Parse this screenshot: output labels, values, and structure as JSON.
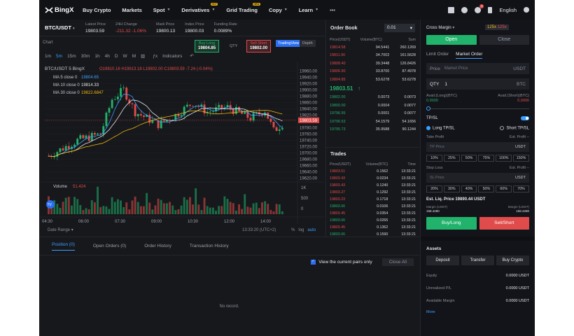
{
  "nav": {
    "logo": "BingX",
    "items": [
      {
        "label": "Buy Crypto",
        "chev": false,
        "badge": ""
      },
      {
        "label": "Markets",
        "chev": false,
        "badge": ""
      },
      {
        "label": "Spot",
        "chev": true,
        "badge": ""
      },
      {
        "label": "Derivatives",
        "chev": true,
        "badge": "HOT"
      },
      {
        "label": "Grid Trading",
        "chev": false,
        "badge": "NEW"
      },
      {
        "label": "Copy",
        "chev": true,
        "badge": ""
      },
      {
        "label": "Learn",
        "chev": true,
        "badge": ""
      }
    ],
    "more": "•••",
    "notif_count": "9",
    "language": "English"
  },
  "ticker": {
    "pair": "BTC/USDT",
    "stats": [
      {
        "label": "Latest Price",
        "value": "19803.59",
        "tone": "normal"
      },
      {
        "label": "24H Change",
        "value": "-211.32 -1.06%",
        "tone": "red"
      },
      {
        "label": "Mark Price",
        "value": "19800.13",
        "tone": "normal"
      },
      {
        "label": "Index Price",
        "value": "19800.03",
        "tone": "normal"
      },
      {
        "label": "Funding Rate",
        "value": "0.0089%",
        "tone": "normal"
      }
    ]
  },
  "chart": {
    "panel_title": "Chart",
    "timeframes": [
      "1m",
      "5m",
      "15m",
      "30m",
      "1h",
      "4h",
      "D",
      "W",
      "M"
    ],
    "active_tf": "5m",
    "indicators_label": "Indicators",
    "buy_long": {
      "label": "Buy Long",
      "price": "19804.85"
    },
    "qty_label": "QTY",
    "sell_short": {
      "label": "Sell Short",
      "price": "19802.00"
    },
    "tradingview_tab": "TradingView",
    "depth_tab": "Depth",
    "legend_pair": "BTC/USDT  5  BingX",
    "ohlc": "O19810.16  H19813.18  L19802.00  C19803.59  -7.24 (-0.04%)",
    "ma5": "MA 5 close 0",
    "ma5_val": "19804.65",
    "ma10": "MA 10 close 0",
    "ma10_val": "19814.33",
    "ma30": "MA 30 close 0",
    "ma30_val": "19822.6847",
    "volume_label": "Volume",
    "volume_val": "51.424",
    "current_price_tag": "19803.59",
    "date_range": "Date Range",
    "clock": "13:33:20 (UTC+2)",
    "pct": "%",
    "log": "log",
    "auto": "auto",
    "tv_logo": "TV"
  },
  "chart_data": {
    "type": "candlestick",
    "price_axis": [
      "19960.00",
      "19940.00",
      "19920.00",
      "19900.00",
      "19880.00",
      "19860.00",
      "19840.00",
      "19820.00",
      "19800.00",
      "19780.00",
      "19760.00",
      "19740.00",
      "19720.00",
      "19700.00",
      "19680.00",
      "19660.00",
      "19640.00",
      "19620.00"
    ],
    "volume_axis": [
      "1K",
      "500",
      "0"
    ],
    "time_axis": [
      "04:30",
      "06:00",
      "07:30",
      "09:00",
      "10:30",
      "12:00",
      "14:00"
    ],
    "ylim": [
      19612,
      19972
    ],
    "series": [
      {
        "name": "MA 5",
        "color": "#3aa0ff"
      },
      {
        "name": "MA 10",
        "color": "#e5e7eb"
      },
      {
        "name": "MA 30",
        "color": "#f0b90b"
      }
    ]
  },
  "orderbook": {
    "title": "Order Book",
    "precision": "0.01",
    "cols": [
      "Price(USDT)",
      "Volume(BTC)",
      "Sum"
    ],
    "asks": [
      [
        "19814.58",
        "94.5441",
        "260.1269"
      ],
      [
        "19811.90",
        "34.7002",
        "161.5628"
      ],
      [
        "19808.40",
        "39.3448",
        "126.8426"
      ],
      [
        "19806.90",
        "33.8700",
        "87.4978"
      ],
      [
        "19804.85",
        "53.6278",
        "53.6278"
      ]
    ],
    "mid": "19803.51",
    "mid_arrow": "↑",
    "bids": [
      [
        "19802.00",
        "0.0073",
        "0.0073"
      ],
      [
        "19800.00",
        "0.0004",
        "0.0077"
      ],
      [
        "19796.95",
        "0.0001",
        "0.0077"
      ],
      [
        "19796.53",
        "54.1579",
        "54.1656"
      ],
      [
        "19795.73",
        "35.9588",
        "90.1244"
      ]
    ]
  },
  "trades": {
    "title": "Trades",
    "cols": [
      "Price(USDT)",
      "Volume(BTC)",
      "Time"
    ],
    "rows": [
      [
        "19803.51",
        "0.1562",
        "13:33:21",
        "red"
      ],
      [
        "19803.43",
        "0.0234",
        "13:33:21",
        "red"
      ],
      [
        "19803.43",
        "0.1240",
        "13:33:21",
        "red"
      ],
      [
        "19803.27",
        "0.1292",
        "13:33:21",
        "red"
      ],
      [
        "19803.23",
        "0.1718",
        "13:33:21",
        "red"
      ],
      [
        "19803.06",
        "0.0106",
        "13:33:21",
        "green"
      ],
      [
        "19803.45",
        "0.0354",
        "13:33:21",
        "red"
      ],
      [
        "19803.06",
        "0.0265",
        "13:33:21",
        "green"
      ],
      [
        "19803.45",
        "0.1362",
        "13:33:21",
        "red"
      ],
      [
        "19803.06",
        "0.1590",
        "13:33:21",
        "green"
      ]
    ]
  },
  "panel": {
    "margin_mode": "Cross Margin",
    "lev_long": "125x",
    "lev_short": "125x",
    "open": "Open",
    "close": "Close",
    "limit_order": "Limit Order",
    "market_order": "Market Order",
    "price_label": "Price",
    "price_placeholder": "Market Price",
    "price_unit": "USDT",
    "qty_label": "QTY",
    "qty_value": "1",
    "qty_unit": "BTC",
    "avail_long_label": "Avail.(Long)(BTC)",
    "avail_short_label": "Avail.(Short)(BTC)",
    "avail_long": "0.0000",
    "avail_short": "0.0000",
    "tpsl": "TP/SL",
    "long_tpsl": "Long TP/SL",
    "short_tpsl": "Short TP/SL",
    "take_profit": "Take Profit",
    "est_profit": "Est. Profit --",
    "tp_price": "TP Price",
    "unit": "USDT",
    "tp_pcts": [
      "10%",
      "25%",
      "50%",
      "75%",
      "100%",
      "150%"
    ],
    "stop_loss": "Stop Loss",
    "sl_price": "SL Price",
    "sl_pcts": [
      "20%",
      "30%",
      "40%",
      "50%",
      "60%",
      "70%"
    ],
    "est_liq": "Est. Liq. Price 19890.44 USDT",
    "margin_label": "Margin (USDT)",
    "margin_long": "158.4280",
    "margin_short": "158.4280",
    "buy_long": "Buy/Long",
    "sell_short": "Sell/Short",
    "assets_title": "Assets",
    "deposit": "Deposit",
    "transfer": "Transfer",
    "buy_crypto": "Buy Crypto",
    "equity_label": "Equity",
    "equity": "0.0000 USDT",
    "upnl_label": "Unrealized P/L",
    "upnl": "0.0000 USDT",
    "avail_margin_label": "Available Margin",
    "avail_margin": "0.0000 USDT",
    "more": "More"
  },
  "positions": {
    "tabs": [
      "Position (0)",
      "Open Orders (0)",
      "Order History",
      "Transaction History"
    ],
    "view_pairs": "View the current pairs only",
    "close_all": "Close All",
    "no_record": "No record."
  }
}
